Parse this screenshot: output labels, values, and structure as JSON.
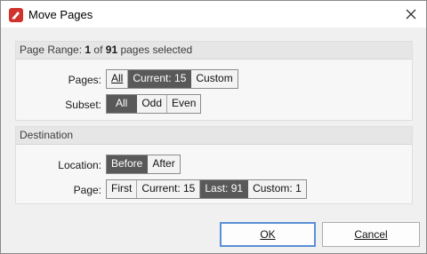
{
  "window": {
    "title": "Move Pages"
  },
  "range": {
    "prefix": "Page Range: ",
    "selected": "1",
    "mid": " of ",
    "total": "91",
    "suffix": " pages selected"
  },
  "pages": {
    "label": "Pages:",
    "options": [
      "All",
      "Current: 15",
      "Custom"
    ],
    "active": "Current: 15"
  },
  "subset": {
    "label": "Subset:",
    "options": [
      "All",
      "Odd",
      "Even"
    ],
    "active": "All"
  },
  "destination": {
    "title": "Destination",
    "location_label": "Location:",
    "location_options": [
      "Before",
      "After"
    ],
    "location_active": "Before",
    "page_label": "Page:",
    "page_options": [
      "First",
      "Current: 15",
      "Last: 91",
      "Custom: 1"
    ],
    "page_active": "Last: 91"
  },
  "buttons": {
    "ok": "OK",
    "cancel": "Cancel"
  },
  "colors": {
    "accent_red": "#d2322d",
    "active_segment": "#595959",
    "default_button_border": "#5a8fd6"
  }
}
